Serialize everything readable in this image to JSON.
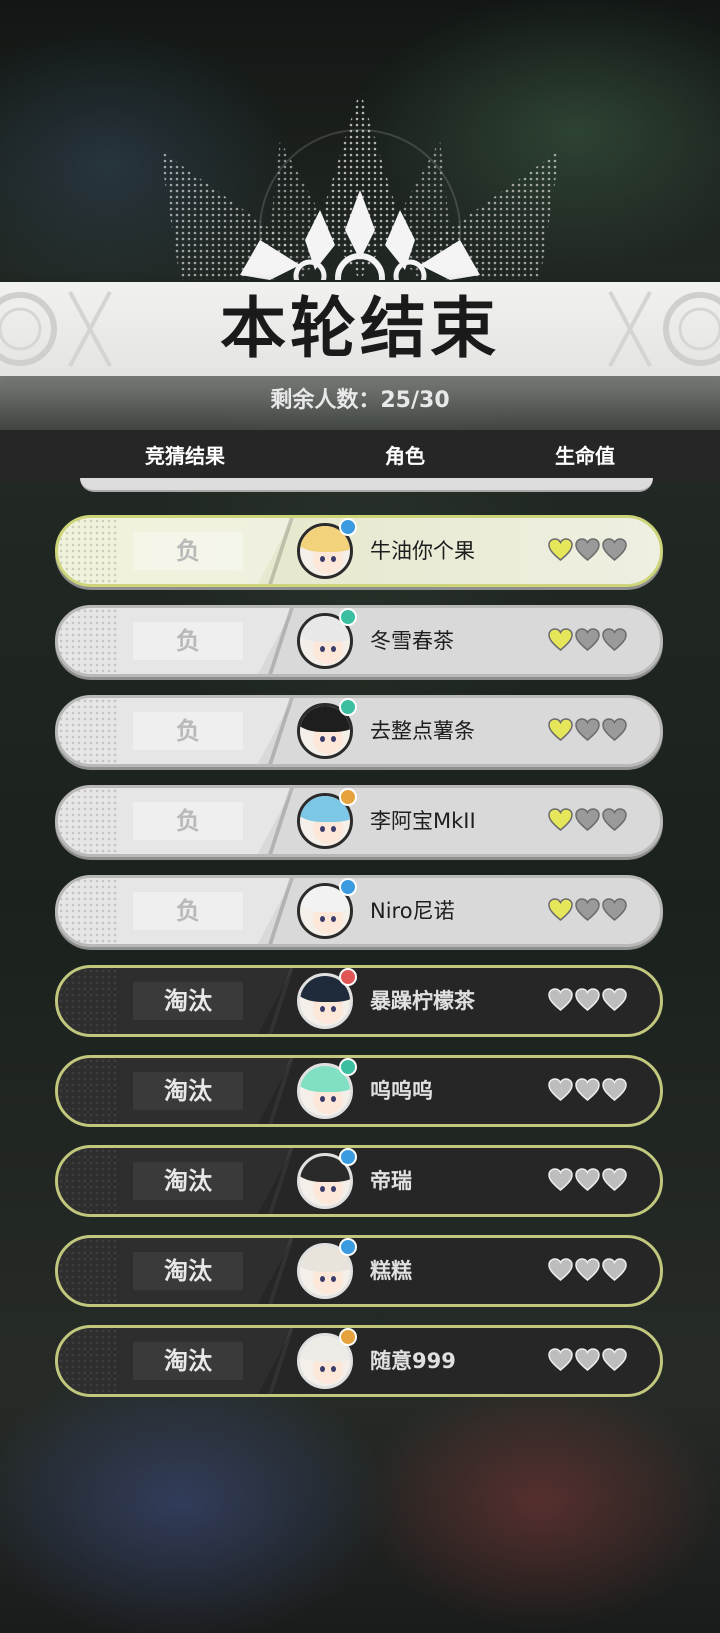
{
  "round": {
    "title": "本轮结束",
    "remaining": "剩余人数：25/30"
  },
  "headers": {
    "result": "竞猜结果",
    "role": "角色",
    "hp": "生命值"
  },
  "colors": {
    "heart_alive": "#e6e65a",
    "heart_lost_light": "#9a9a9a",
    "heart_lost_dark": "#bdbdbd",
    "row_border_dark": "#c2c77e",
    "highlight_border": "#cdd47a"
  },
  "players": [
    {
      "result": "负",
      "name": "牛油你个果",
      "hp": 1,
      "max_hp": 3,
      "state": "me",
      "hair": "#f2d27a",
      "badge": "#3a9be0"
    },
    {
      "result": "负",
      "name": "冬雪春茶",
      "hp": 1,
      "max_hp": 3,
      "state": "alive",
      "hair": "#e8e8e8",
      "badge": "#3bbfa0"
    },
    {
      "result": "负",
      "name": "去整点薯条",
      "hp": 1,
      "max_hp": 3,
      "state": "alive",
      "hair": "#1e1e1e",
      "badge": "#3bbfa0"
    },
    {
      "result": "负",
      "name": "李阿宝MkII",
      "hp": 1,
      "max_hp": 3,
      "state": "alive",
      "hair": "#7cc7e6",
      "badge": "#e6a23c"
    },
    {
      "result": "负",
      "name": "Niro尼诺",
      "hp": 1,
      "max_hp": 3,
      "state": "alive",
      "hair": "#f2f2f2",
      "badge": "#3a9be0"
    },
    {
      "result": "淘汰",
      "name": "暴躁柠檬茶",
      "hp": 0,
      "max_hp": 3,
      "state": "out",
      "hair": "#1f2a3a",
      "badge": "#e05656"
    },
    {
      "result": "淘汰",
      "name": "呜呜呜",
      "hp": 0,
      "max_hp": 3,
      "state": "out",
      "hair": "#7fe0c4",
      "badge": "#3bbfa0"
    },
    {
      "result": "淘汰",
      "name": "帝瑞",
      "hp": 0,
      "max_hp": 3,
      "state": "out",
      "hair": "#2a2a2a",
      "badge": "#3a9be0"
    },
    {
      "result": "淘汰",
      "name": "糕糕",
      "hp": 0,
      "max_hp": 3,
      "state": "out",
      "hair": "#e8e4dc",
      "badge": "#3a9be0"
    },
    {
      "result": "淘汰",
      "name": "随意999",
      "hp": 0,
      "max_hp": 3,
      "state": "out",
      "hair": "#ecebe6",
      "badge": "#e6a23c"
    }
  ]
}
